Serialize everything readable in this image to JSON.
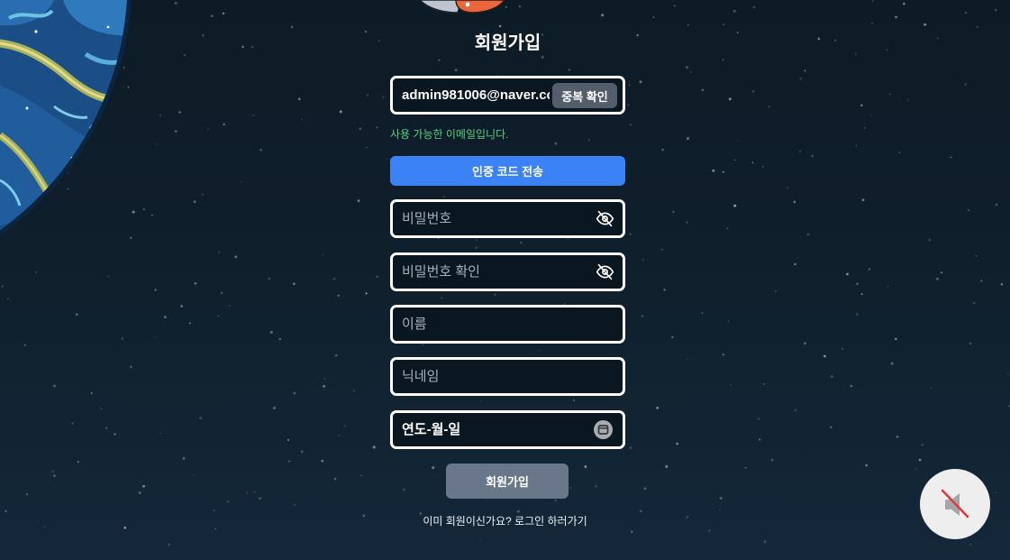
{
  "page": {
    "title": "회원가입"
  },
  "form": {
    "email": {
      "value": "admin981006@naver.cc",
      "check_button_label": "중복 확인",
      "status_message": "사용 가능한 이메일입니다."
    },
    "send_code_button_label": "인증 코드 전송",
    "password": {
      "placeholder": "비밀번호",
      "toggle_icon": "eye-off-icon"
    },
    "password_confirm": {
      "placeholder": "비밀번호 확인",
      "toggle_icon": "eye-off-icon"
    },
    "name": {
      "placeholder": "이름"
    },
    "nickname": {
      "placeholder": "닉네임"
    },
    "birthdate": {
      "value": "연도-월-일",
      "icon": "calendar-icon"
    },
    "submit_button_label": "회원가입",
    "login_prompt": "이미 회원이신가요?",
    "login_link": "로그인 하러가기"
  },
  "sound_toggle": {
    "icon": "speaker-muted-icon"
  },
  "decor": {
    "planet_icon": "planet-icon",
    "rocket_icon": "rocket-icon"
  },
  "colors": {
    "background": "#0f1e2a",
    "field_border": "#ffffff",
    "primary": "#3b82f6",
    "success": "#4bd27f",
    "secondary_button": "#535d6b",
    "submit_button": "#6a778b",
    "mute_slash": "#e53935"
  }
}
